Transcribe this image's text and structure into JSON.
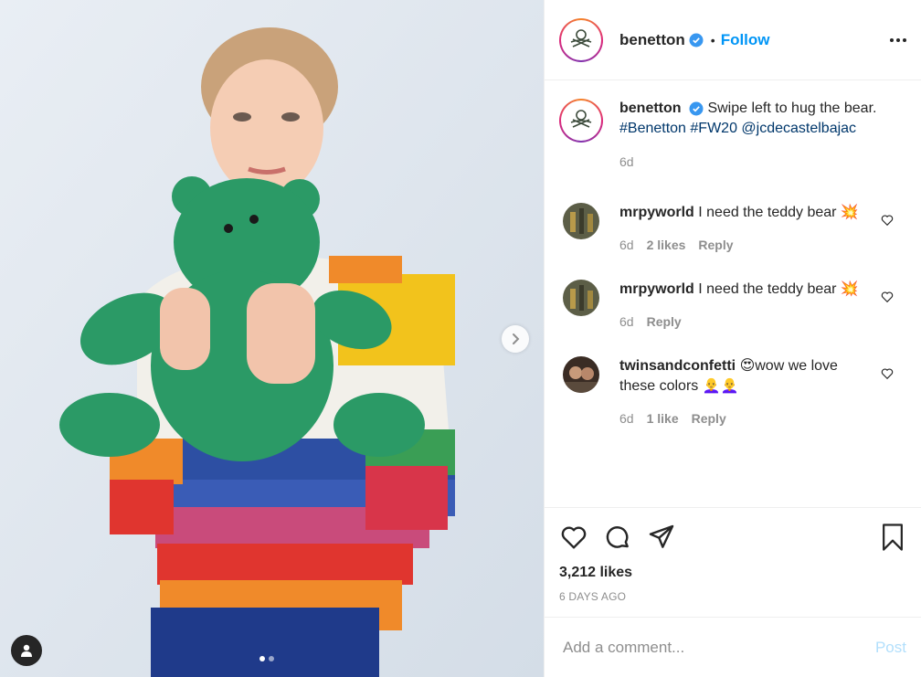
{
  "post": {
    "username": "benetton",
    "separator": "•",
    "follow_label": "Follow",
    "caption_text": "Swipe left to hug the bear.",
    "caption_tags": "#Benetton #FW20 @jcdecastelbajac",
    "caption_time": "6d",
    "likes": "3,212 likes",
    "posted_ago": "6 DAYS AGO"
  },
  "comments": [
    {
      "username": "mrpyworld",
      "text": "I need the teddy bear 💥",
      "time": "6d",
      "likes": "2 likes",
      "reply": "Reply"
    },
    {
      "username": "mrpyworld",
      "text": "I need the teddy bear 💥",
      "time": "6d",
      "likes": "",
      "reply": "Reply"
    },
    {
      "username": "twinsandconfetti",
      "text": "😍wow we love these colors 👩‍🦲👩‍🦲",
      "time": "6d",
      "likes": "1 like",
      "reply": "Reply"
    }
  ],
  "comment_box": {
    "placeholder": "Add a comment...",
    "post_label": "Post"
  },
  "carousel": {
    "index": 1,
    "count": 2
  },
  "colors": {
    "accent": "#0095f6",
    "link": "#00376b",
    "muted": "#8e8e8e",
    "post_disabled": "#b2dffc"
  }
}
